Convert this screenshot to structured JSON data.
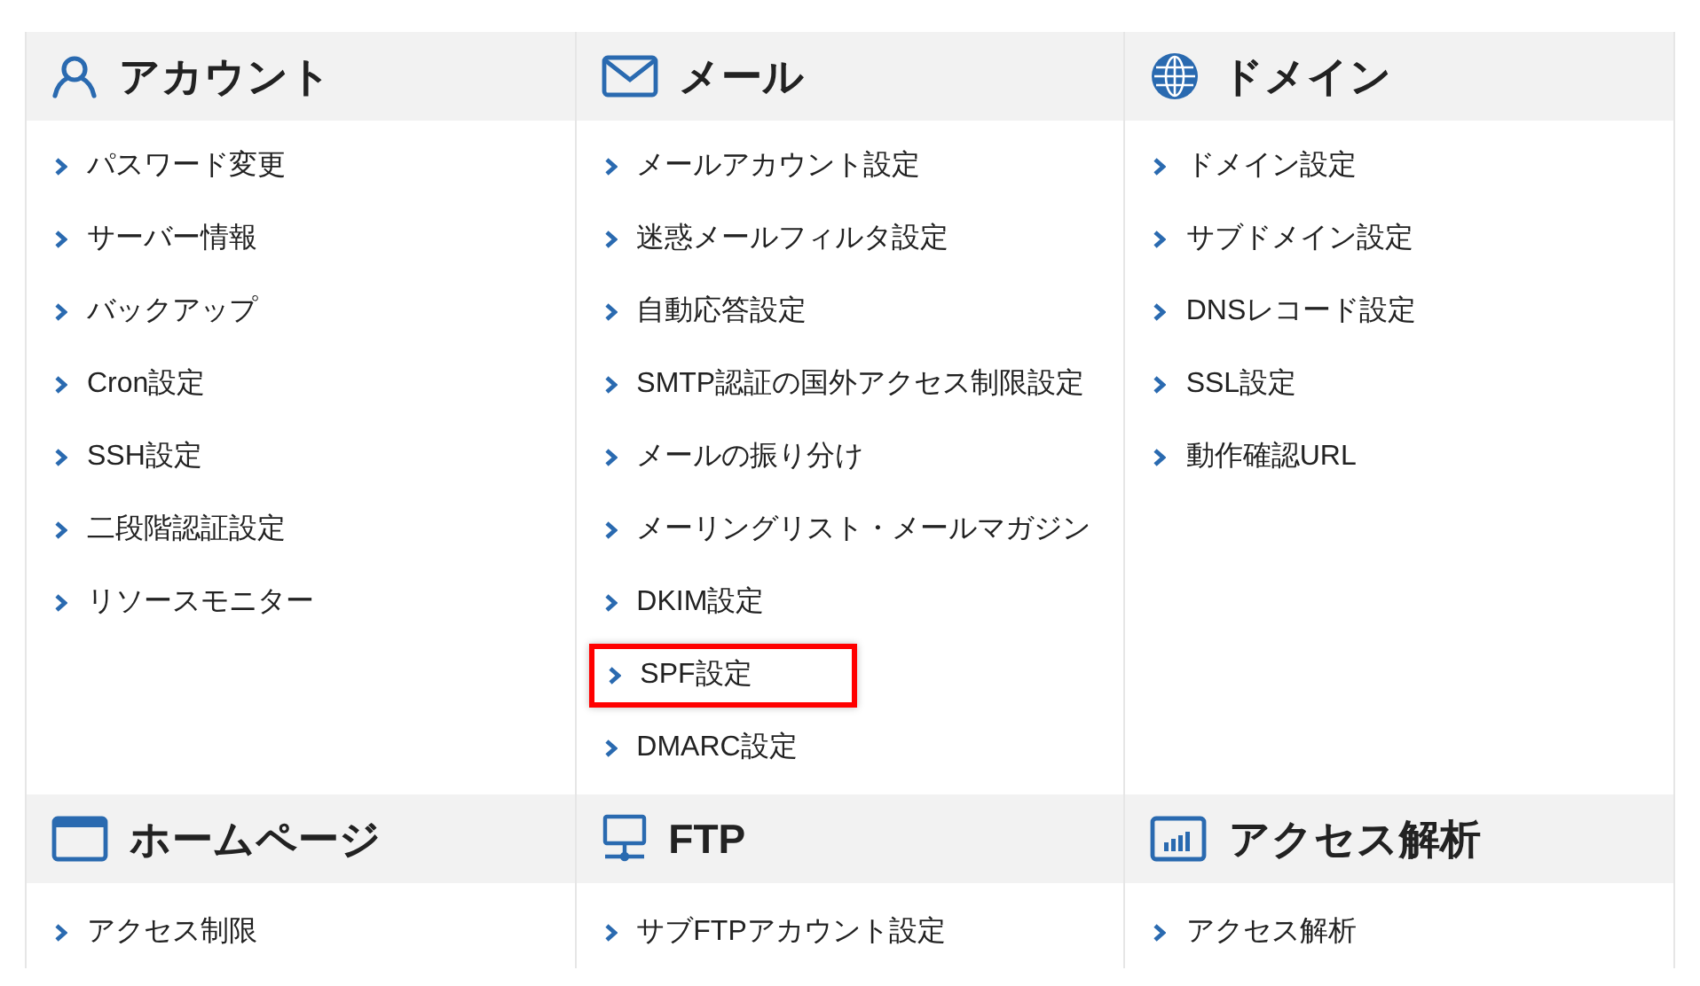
{
  "sections": [
    {
      "title": "アカウント",
      "items": [
        {
          "label": "パスワード変更",
          "highlighted": false
        },
        {
          "label": "サーバー情報",
          "highlighted": false
        },
        {
          "label": "バックアップ",
          "highlighted": false
        },
        {
          "label": "Cron設定",
          "highlighted": false
        },
        {
          "label": "SSH設定",
          "highlighted": false
        },
        {
          "label": "二段階認証設定",
          "highlighted": false
        },
        {
          "label": "リソースモニター",
          "highlighted": false
        }
      ]
    },
    {
      "title": "メール",
      "items": [
        {
          "label": "メールアカウント設定",
          "highlighted": false
        },
        {
          "label": "迷惑メールフィルタ設定",
          "highlighted": false
        },
        {
          "label": "自動応答設定",
          "highlighted": false
        },
        {
          "label": "SMTP認証の国外アクセス制限設定",
          "highlighted": false
        },
        {
          "label": "メールの振り分け",
          "highlighted": false
        },
        {
          "label": "メーリングリスト・メールマガジン",
          "highlighted": false
        },
        {
          "label": "DKIM設定",
          "highlighted": false
        },
        {
          "label": "SPF設定",
          "highlighted": true
        },
        {
          "label": "DMARC設定",
          "highlighted": false
        }
      ]
    },
    {
      "title": "ドメイン",
      "items": [
        {
          "label": "ドメイン設定",
          "highlighted": false
        },
        {
          "label": "サブドメイン設定",
          "highlighted": false
        },
        {
          "label": "DNSレコード設定",
          "highlighted": false
        },
        {
          "label": "SSL設定",
          "highlighted": false
        },
        {
          "label": "動作確認URL",
          "highlighted": false
        }
      ]
    },
    {
      "title": "ホームページ",
      "items": [
        {
          "label": "アクセス制限",
          "highlighted": false
        }
      ]
    },
    {
      "title": "FTP",
      "items": [
        {
          "label": "サブFTPアカウント設定",
          "highlighted": false
        }
      ]
    },
    {
      "title": "アクセス解析",
      "items": [
        {
          "label": "アクセス解析",
          "highlighted": false
        }
      ]
    }
  ]
}
